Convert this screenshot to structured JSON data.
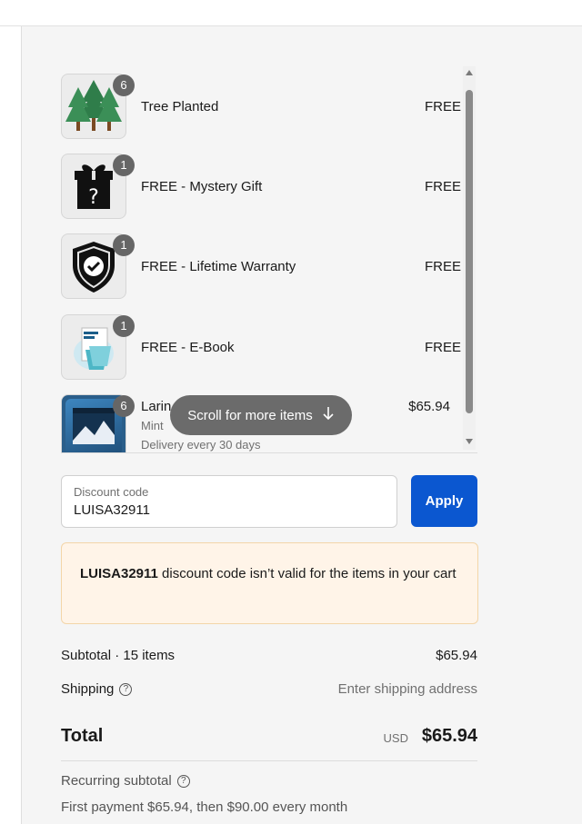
{
  "items": [
    {
      "name": "Tree Planted",
      "price": "FREE",
      "qty": "6",
      "icon": "trees-icon"
    },
    {
      "name": "FREE - Mystery Gift",
      "price": "FREE",
      "qty": "1",
      "icon": "mystery-gift-icon"
    },
    {
      "name": "FREE - Lifetime Warranty",
      "price": "FREE",
      "qty": "1",
      "icon": "shield-check-icon"
    },
    {
      "name": "FREE - E-Book",
      "price": "FREE",
      "qty": "1",
      "icon": "ebook-icon"
    },
    {
      "name": "Larin",
      "variant": "Mint",
      "note": "Delivery every 30 days",
      "price": "$65.94",
      "qty": "6",
      "icon": "product-image"
    }
  ],
  "scroll_hint": "Scroll for more items",
  "discount": {
    "label": "Discount code",
    "value": "LUISA32911",
    "apply": "Apply"
  },
  "error": {
    "code": "LUISA32911",
    "message": " discount code isn’t valid for the items in your cart"
  },
  "subtotal": {
    "label": "Subtotal · 15 items",
    "value": "$65.94"
  },
  "shipping": {
    "label": "Shipping",
    "value": "Enter shipping address"
  },
  "total": {
    "label": "Total",
    "currency": "USD",
    "value": "$65.94"
  },
  "recurring": {
    "label": "Recurring subtotal",
    "detail": "First payment $65.94, then $90.00 every month"
  },
  "colors": {
    "accent": "#0b57d0",
    "error_bg": "#fff4e8",
    "badge": "#666666"
  }
}
